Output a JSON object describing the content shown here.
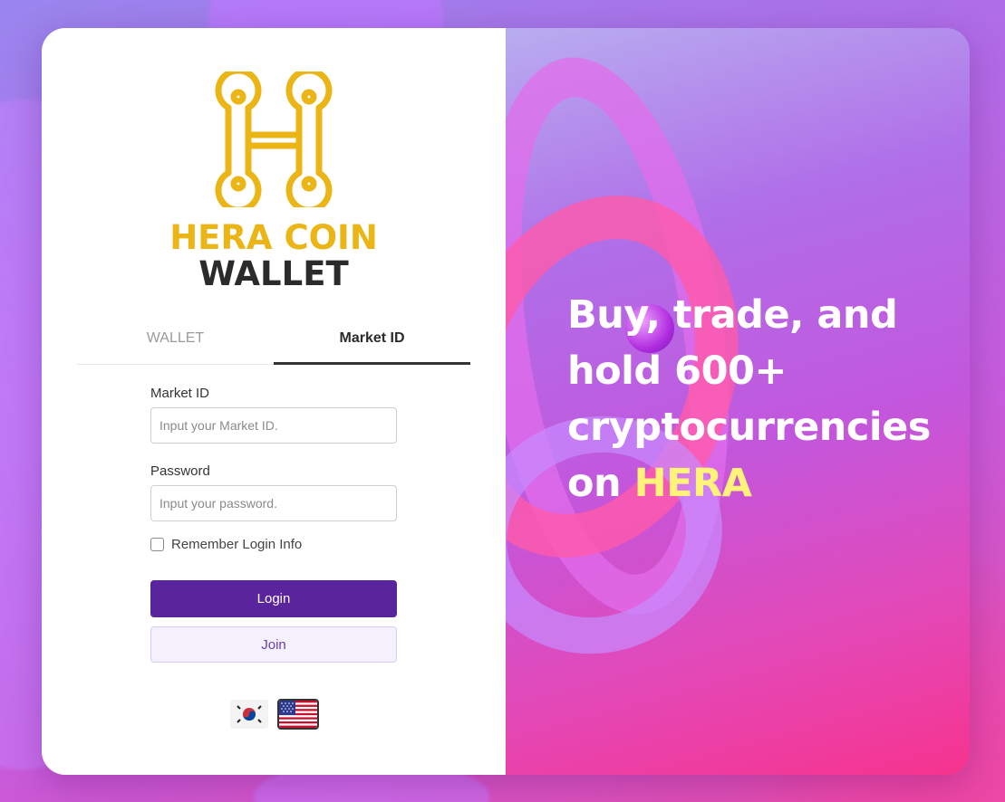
{
  "brand": {
    "line1": "HERA COIN",
    "line2": "WALLET",
    "logo_icon": "hera-h-logo-icon",
    "logo_color": "#eab515"
  },
  "tabs": [
    {
      "label": "WALLET",
      "active": false
    },
    {
      "label": "Market ID",
      "active": true
    }
  ],
  "form": {
    "market_id_label": "Market ID",
    "market_id_placeholder": "Input your Market ID.",
    "password_label": "Password",
    "password_placeholder": "Input your password.",
    "remember_label": "Remember Login Info",
    "login_label": "Login",
    "join_label": "Join"
  },
  "languages": [
    {
      "name": "korean-flag-icon"
    },
    {
      "name": "us-flag-icon"
    }
  ],
  "promo": {
    "line1": "Buy, trade, and",
    "line2": "hold 600+",
    "line3": "cryptocurrencies",
    "line4_prefix": "on ",
    "line4_highlight": "HERA"
  },
  "colors": {
    "primary": "#5a249c",
    "highlight": "#fff37a"
  }
}
